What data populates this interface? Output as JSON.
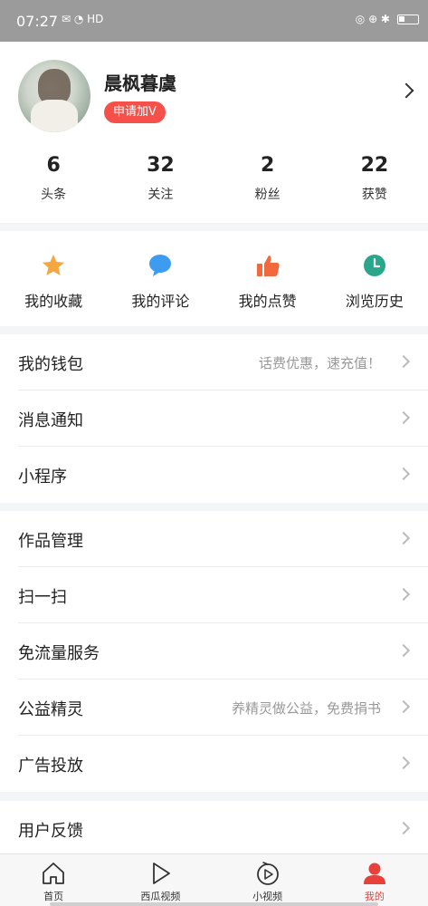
{
  "status_bar": {
    "time": "07:27",
    "left_icons": "✉ ◔ HD",
    "right_icons": "◎ ⊕ ✱"
  },
  "profile": {
    "username": "晨枫暮虞",
    "apply_badge": "申请加V",
    "stats": [
      {
        "value": "6",
        "label": "头条"
      },
      {
        "value": "32",
        "label": "关注"
      },
      {
        "value": "2",
        "label": "粉丝"
      },
      {
        "value": "22",
        "label": "获赞"
      }
    ]
  },
  "actions": [
    {
      "label": "我的收藏",
      "icon": "star-icon",
      "color": "#f5a63f"
    },
    {
      "label": "我的评论",
      "icon": "comment-icon",
      "color": "#3e9cf0"
    },
    {
      "label": "我的点赞",
      "icon": "thumbs-up-icon",
      "color": "#f2693d"
    },
    {
      "label": "浏览历史",
      "icon": "clock-icon",
      "color": "#2aa78a"
    }
  ],
  "menu_groups": [
    [
      {
        "label": "我的钱包",
        "hint": "话费优惠，速充值！"
      },
      {
        "label": "消息通知",
        "hint": ""
      },
      {
        "label": "小程序",
        "hint": ""
      }
    ],
    [
      {
        "label": "作品管理",
        "hint": ""
      },
      {
        "label": "扫一扫",
        "hint": ""
      },
      {
        "label": "免流量服务",
        "hint": ""
      },
      {
        "label": "公益精灵",
        "hint": "养精灵做公益，免费捐书"
      },
      {
        "label": "广告投放",
        "hint": ""
      }
    ],
    [
      {
        "label": "用户反馈",
        "hint": ""
      }
    ]
  ],
  "bottom_nav": [
    {
      "label": "首页",
      "icon": "home-icon",
      "active": false
    },
    {
      "label": "西瓜视频",
      "icon": "play-icon",
      "active": false
    },
    {
      "label": "小视频",
      "icon": "short-video-icon",
      "active": false
    },
    {
      "label": "我的",
      "icon": "user-icon",
      "active": true
    }
  ],
  "colors": {
    "accent": "#e8403b",
    "badge": "#f5514a"
  }
}
